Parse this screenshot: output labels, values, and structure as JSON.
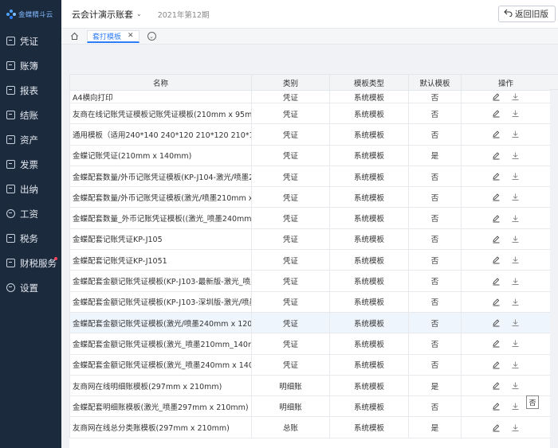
{
  "logo": {
    "text": "金蝶精斗云"
  },
  "sidebar": {
    "items": [
      {
        "label": "凭证",
        "icon": "voucher-icon"
      },
      {
        "label": "账簿",
        "icon": "ledger-icon"
      },
      {
        "label": "报表",
        "icon": "report-icon"
      },
      {
        "label": "结账",
        "icon": "closing-icon"
      },
      {
        "label": "资产",
        "icon": "asset-icon"
      },
      {
        "label": "发票",
        "icon": "invoice-icon"
      },
      {
        "label": "出纳",
        "icon": "cashier-icon"
      },
      {
        "label": "工资",
        "icon": "salary-icon"
      },
      {
        "label": "税务",
        "icon": "tax-icon"
      },
      {
        "label": "财税服务",
        "icon": "service-icon"
      },
      {
        "label": "设置",
        "icon": "gear-icon"
      }
    ]
  },
  "header": {
    "account": "云会计演示账套",
    "period": "2021年第12期",
    "back_label": "返回旧版"
  },
  "tabs": [
    {
      "label": "套打模板"
    }
  ],
  "table": {
    "columns": [
      "名称",
      "类别",
      "模板类型",
      "默认模板",
      "操作"
    ],
    "rows": [
      {
        "name": "A4横向打印",
        "category": "凭证",
        "type": "系统模板",
        "default": "否"
      },
      {
        "name": "友商在线记账凭证模板记账凭证模板(210mm x 95mm)",
        "category": "凭证",
        "type": "系统模板",
        "default": "否"
      },
      {
        "name": "通用模板（适用240*140 240*120 210*120 210*140的空白纸）",
        "category": "凭证",
        "type": "系统模板",
        "default": "否"
      },
      {
        "name": "金蝶记账凭证(210mm x 140mm)",
        "category": "凭证",
        "type": "系统模板",
        "default": "是"
      },
      {
        "name": "金蝶配套数量/外币记账凭证模板(KP-J104-激光/喷墨240mm x 140mm)",
        "category": "凭证",
        "type": "系统模板",
        "default": "否"
      },
      {
        "name": "金蝶配套数量/外币记账凭证模板(激光/喷墨210mm x 140mm)",
        "category": "凭证",
        "type": "系统模板",
        "default": "否"
      },
      {
        "name": "金蝶配套数量_外币记账凭证模板((激光_喷墨240mm x 140mm)",
        "category": "凭证",
        "type": "系统模板",
        "default": "否"
      },
      {
        "name": "金蝶配套记账凭证KP-J105",
        "category": "凭证",
        "type": "系统模板",
        "default": "否"
      },
      {
        "name": "金蝶配套记账凭证KP-J1051",
        "category": "凭证",
        "type": "系统模板",
        "default": "否"
      },
      {
        "name": "金蝶配套金额记账凭证模板(KP-J103-最新版-激光_喷墨240mm)",
        "category": "凭证",
        "type": "系统模板",
        "default": "否"
      },
      {
        "name": "金蝶配套金额记账凭证模板(KP-J103-深圳版-激光/喷墨240mm)",
        "category": "凭证",
        "type": "系统模板",
        "default": "否"
      },
      {
        "name": "金蝶配套金额记账凭证模板(激光/喷墨240mm x 120mm)",
        "category": "凭证",
        "type": "系统模板",
        "default": "否"
      },
      {
        "name": "金蝶配套金额记账凭证模板(激光_喷墨210mm_140mm)",
        "category": "凭证",
        "type": "系统模板",
        "default": "否"
      },
      {
        "name": "金蝶配套金额记账凭证模板(激光_喷墨240mm x 140mm)",
        "category": "凭证",
        "type": "系统模板",
        "default": "否"
      },
      {
        "name": "友商网在线明细账模板(297mm x 210mm)",
        "category": "明细账",
        "type": "系统模板",
        "default": "是"
      },
      {
        "name": "金蝶配套明细账模板(激光_喷墨297mm x 210mm)",
        "category": "明细账",
        "type": "系统模板",
        "default": "否"
      },
      {
        "name": "友商网在线总分类账模板(297mm x 210mm)",
        "category": "总账",
        "type": "系统模板",
        "default": "是"
      }
    ]
  },
  "tooltip": {
    "text": "否"
  },
  "colors": {
    "sidebar_bg": "#1c2a3d",
    "accent": "#2f7df6",
    "row_highlight": "#eef5fd"
  }
}
